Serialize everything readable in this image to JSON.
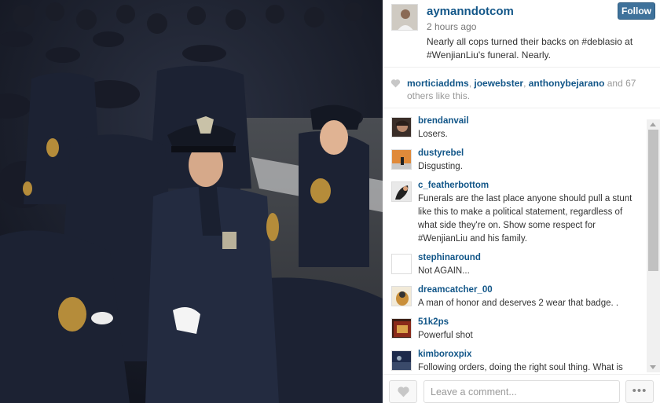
{
  "post": {
    "username": "aymanndotcom",
    "time_ago": "2 hours ago",
    "caption": "Nearly all cops turned their backs on #deblasio at #WenjianLiu's funeral. Nearly.",
    "follow_label": "Follow"
  },
  "likes": {
    "names": [
      "morticiaddms",
      "joewebster",
      "anthonybejarano"
    ],
    "sep1": ", ",
    "sep2": ", ",
    "suffix": " and 67 others like this.",
    "heart_color": "#c7c7c7"
  },
  "comments": [
    {
      "user": "brendanvail",
      "text": "Losers."
    },
    {
      "user": "dustyrebel",
      "text": "Disgusting."
    },
    {
      "user": "c_featherbottom",
      "text": "Funerals are the last place anyone should pull a stunt like this to make a political statement, regardless of what side they're on. Show some respect for #WenjianLiu and his family."
    },
    {
      "user": "stephinaround",
      "text": "Not AGAIN..."
    },
    {
      "user": "dreamcatcher_00",
      "text": "A man of honor and deserves 2 wear that badge. ."
    },
    {
      "user": "51k2ps",
      "text": "Powerful shot"
    },
    {
      "user": "kimboroxpix",
      "text": "Following orders, doing the right soul thing. What is"
    }
  ],
  "footer": {
    "comment_placeholder": "Leave a comment...",
    "more_label": "•••"
  },
  "colors": {
    "username": "#125688",
    "follow_bg": "#3f729b"
  }
}
